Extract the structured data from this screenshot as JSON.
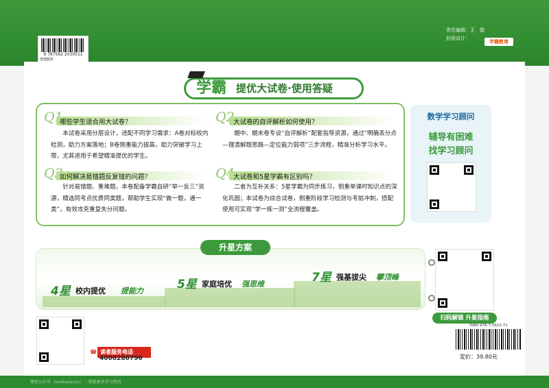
{
  "top": {
    "barcode_number": "9 787562 2030511",
    "barcode_tag": "增值服务",
    "editor_line1": "责任编辑：王　霞",
    "editor_line2": "封面设计：",
    "publisher_logo": "学霸教育"
  },
  "title": {
    "brand": "学霸",
    "rest": "提优大试卷·使用答疑"
  },
  "qa": [
    {
      "num": "Q1",
      "title": "哪些学生适合用大试卷？",
      "text": "本试卷采用分层设计，适配不同学习需求：A卷对标校内检测，助力方案落地；B卷侧重能力拔高，助力突破学习上限，尤其适用于希望精准提优的学生。"
    },
    {
      "num": "Q2",
      "title": "大试卷的自评解析如何使用？",
      "text": "期中、期末卷专设“自评解析”配套指导资源，通过“明确丢分点—理清解题思路—定位能力弱项”三步流程，精准分析学习水平。"
    },
    {
      "num": "Q3",
      "title": "如何解决易错题反复错的问题？",
      "text": "针对易错题、重难题，本卷配备学霸自研“举一反三”资源，精选同考点优质同类题，帮助学生实现“做一题，通一类”，有效攻克重复失分问题。"
    },
    {
      "num": "Q4",
      "title": "大试卷和5星学霸有区别吗？",
      "text": "二者为互补关系：5星学霸为同步练习，侧重单课时知识点的深化巩固；本试卷为综合试卷，侧重阶段学习检测与考前冲刺，搭配使用可实现“学一练一测”全流程覆盖。"
    }
  ],
  "advisor": {
    "title": "数学学习顾问",
    "line1": "辅导有困难",
    "line2": "找学习顾问"
  },
  "plan": {
    "heading": "升星方案",
    "steps": [
      {
        "star": "4星",
        "label": "校内提优",
        "emph": "提能力"
      },
      {
        "star": "5星",
        "label": "家庭培优",
        "emph": "强思维"
      },
      {
        "star": "7星",
        "label": "强基拔尖",
        "emph": "攀顶峰"
      }
    ],
    "scan": "扫码解锁 升星指南"
  },
  "bottom": {
    "phone_label": "读者服务电话",
    "phone": "4008280796",
    "isbn": "ISBN 978-7-5622-71",
    "price": "定价：39.80元",
    "footer_note": "微信公众号（xuebajiaoyu）｜获取更多学习资讯"
  },
  "colors": {
    "green": "#3c9a3c",
    "band": "#2e8a2f",
    "red": "#d8281c",
    "advisor_blue": "#1e6a9c"
  }
}
